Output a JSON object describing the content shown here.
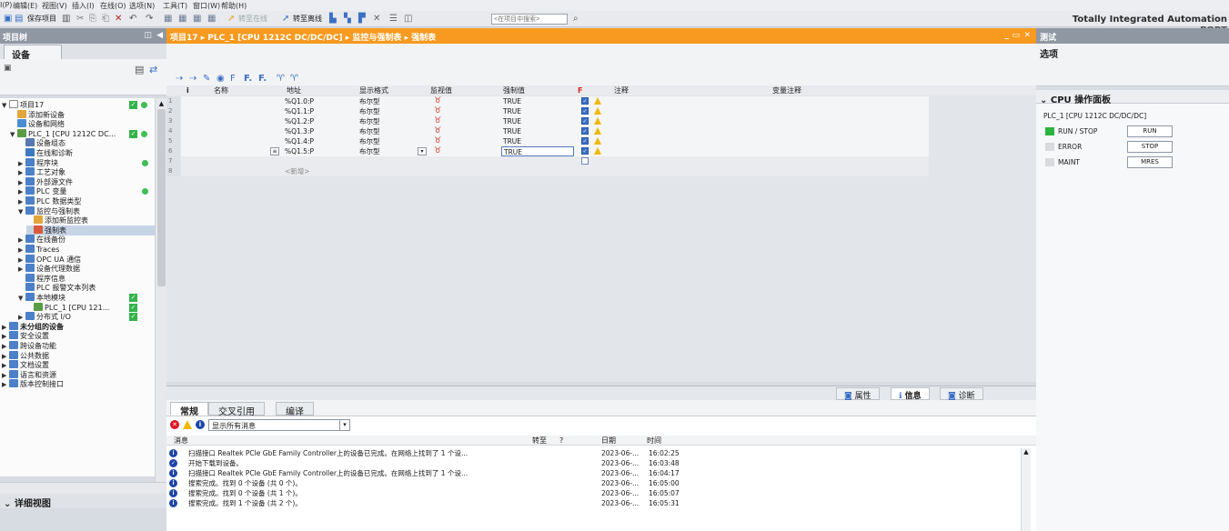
{
  "menu": [
    "I(P)",
    "编辑(E)",
    "视图(V)",
    "插入(I)",
    "在线(O)",
    "选项(N)",
    "工具(T)",
    "窗口(W)",
    "帮助(H)"
  ],
  "toolbar": {
    "save_label": "保存项目",
    "go_online": "转至在线",
    "go_offline": "转至离线",
    "search_placeholder": "<在项目中搜索>"
  },
  "brand": {
    "line1": "Totally Integrated Automation",
    "line2": "PORT"
  },
  "left": {
    "header": "项目树",
    "tab": "设备",
    "tree": [
      {
        "label": "项目17",
        "indent": 0,
        "arrow": "▼",
        "color": "#ffffff",
        "checks": [
          "chk",
          "dot"
        ]
      },
      {
        "label": "添加新设备",
        "indent": 1,
        "arrow": "",
        "color": "#e4a63b"
      },
      {
        "label": "设备和网络",
        "indent": 1,
        "arrow": "",
        "color": "#4a8ed2"
      },
      {
        "label": "PLC_1 [CPU 1212C DC...",
        "indent": 1,
        "arrow": "▼",
        "color": "#5a9c45",
        "checks": [
          "chk",
          "dot"
        ]
      },
      {
        "label": "设备组态",
        "indent": 2,
        "arrow": "",
        "color": "#5578b0"
      },
      {
        "label": "在线和诊断",
        "indent": 2,
        "arrow": "",
        "color": "#3d7ac2"
      },
      {
        "label": "程序块",
        "indent": 2,
        "arrow": "▶",
        "color": "#4c80c8",
        "checks": [
          "dot"
        ]
      },
      {
        "label": "工艺对象",
        "indent": 2,
        "arrow": "▶",
        "color": "#4c80c8"
      },
      {
        "label": "外部源文件",
        "indent": 2,
        "arrow": "▶",
        "color": "#4c80c8"
      },
      {
        "label": "PLC 变量",
        "indent": 2,
        "arrow": "▶",
        "color": "#4c80c8",
        "checks": [
          "dot"
        ]
      },
      {
        "label": "PLC 数据类型",
        "indent": 2,
        "arrow": "▶",
        "color": "#4c80c8"
      },
      {
        "label": "监控与强制表",
        "indent": 2,
        "arrow": "▼",
        "color": "#4c80c8"
      },
      {
        "label": "添加新监控表",
        "indent": 3,
        "arrow": "",
        "color": "#e4a63b"
      },
      {
        "label": "强制表",
        "indent": 3,
        "arrow": "",
        "color": "#d95a3a",
        "selected": true
      },
      {
        "label": "在线备份",
        "indent": 2,
        "arrow": "▶",
        "color": "#4c80c8"
      },
      {
        "label": "Traces",
        "indent": 2,
        "arrow": "▶",
        "color": "#4c80c8"
      },
      {
        "label": "OPC UA 通信",
        "indent": 2,
        "arrow": "▶",
        "color": "#4c80c8"
      },
      {
        "label": "设备代理数据",
        "indent": 2,
        "arrow": "▶",
        "color": "#4c80c8"
      },
      {
        "label": "程序信息",
        "indent": 2,
        "arrow": "",
        "color": "#4c80c8"
      },
      {
        "label": "PLC 报警文本列表",
        "indent": 2,
        "arrow": "",
        "color": "#4c80c8"
      },
      {
        "label": "本地模块",
        "indent": 2,
        "arrow": "▼",
        "color": "#4c80c8",
        "checks": [
          "chk"
        ]
      },
      {
        "label": "PLC_1 [CPU 121...",
        "indent": 3,
        "arrow": "",
        "color": "#5a9c45",
        "checks": [
          "chk"
        ]
      },
      {
        "label": "分布式 I/O",
        "indent": 2,
        "arrow": "▶",
        "color": "#4c80c8",
        "checks": [
          "chk"
        ]
      },
      {
        "label": "未分组的设备",
        "indent": 0,
        "arrow": "▶",
        "color": "#4c80c8",
        "bold": true
      },
      {
        "label": "安全设置",
        "indent": 0,
        "arrow": "▶",
        "color": "#4c80c8"
      },
      {
        "label": "跨设备功能",
        "indent": 0,
        "arrow": "▶",
        "color": "#4c80c8"
      },
      {
        "label": "公共数据",
        "indent": 0,
        "arrow": "▶",
        "color": "#4c80c8"
      },
      {
        "label": "文档设置",
        "indent": 0,
        "arrow": "▶",
        "color": "#4c80c8"
      },
      {
        "label": "语言和资源",
        "indent": 0,
        "arrow": "▶",
        "color": "#4c80c8"
      },
      {
        "label": "版本控制接口",
        "indent": 0,
        "arrow": "▶",
        "color": "#4c80c8"
      }
    ],
    "detail_view": "详细视图"
  },
  "center": {
    "breadcrumb": "项目17 ▸ PLC_1 [CPU 1212C DC/DC/DC] ▸ 监控与强制表 ▸ 强制表",
    "columns": {
      "i": "i",
      "name": "名称",
      "address": "地址",
      "format": "显示格式",
      "monitor": "监视值",
      "force": "强制值",
      "f": "F",
      "comment": "注释",
      "var_comment": "变量注释"
    },
    "rows": [
      {
        "n": "1",
        "address": "%Q1.0:P",
        "format": "布尔型",
        "force": "TRUE",
        "checked": true
      },
      {
        "n": "2",
        "address": "%Q1.1:P",
        "format": "布尔型",
        "force": "TRUE",
        "checked": true
      },
      {
        "n": "3",
        "address": "%Q1.2:P",
        "format": "布尔型",
        "force": "TRUE",
        "checked": true
      },
      {
        "n": "4",
        "address": "%Q1.3:P",
        "format": "布尔型",
        "force": "TRUE",
        "checked": true
      },
      {
        "n": "5",
        "address": "%Q1.4:P",
        "format": "布尔型",
        "force": "TRUE",
        "checked": true
      },
      {
        "n": "6",
        "address": "%Q1.5:P",
        "format": "布尔型",
        "force": "TRUE",
        "checked": true
      },
      {
        "n": "7",
        "address": "",
        "format": "",
        "force": "",
        "checked": false
      },
      {
        "n": "8",
        "address": "<新增>",
        "format": "",
        "force": "",
        "checked": false
      }
    ]
  },
  "bottom": {
    "prop_tabs": [
      "属性",
      "信息",
      "诊断"
    ],
    "info_tabs": [
      "常规",
      "交叉引用",
      "编译"
    ],
    "filter": "显示所有消息",
    "msg_cols": {
      "msg": "消息",
      "goto": "转至",
      "q": "?",
      "date": "日期",
      "time": "时间"
    },
    "messages": [
      {
        "text": "扫描接口 Realtek PCIe GbE Family Controller上的设备已完成。在网络上找到了 1 个设...",
        "date": "2023-06-...",
        "time": "16:02:25",
        "kind": "info"
      },
      {
        "text": "开始下载到设备。",
        "date": "2023-06-...",
        "time": "16:03:48",
        "kind": "ok"
      },
      {
        "text": "扫描接口 Realtek PCIe GbE Family Controller上的设备已完成。在网络上找到了 1 个设...",
        "date": "2023-06-...",
        "time": "16:04:17",
        "kind": "info"
      },
      {
        "text": "搜索完成。找到 0 个设备 (共 0 个)。",
        "date": "2023-06-...",
        "time": "16:05:00",
        "kind": "info"
      },
      {
        "text": "搜索完成。找到 0 个设备 (共 1 个)。",
        "date": "2023-06-...",
        "time": "16:05:07",
        "kind": "info"
      },
      {
        "text": "搜索完成。找到 1 个设备 (共 2 个)。",
        "date": "2023-06-...",
        "time": "16:05:31",
        "kind": "info"
      }
    ]
  },
  "right": {
    "header": "测试",
    "sub": "选项",
    "panel_title": "CPU 操作面板",
    "cpu_name": "PLC_1 [CPU 1212C DC/DC/DC]",
    "leds": [
      {
        "label": "RUN / STOP",
        "button": "RUN",
        "color": "#2cb53e"
      },
      {
        "label": "ERROR",
        "button": "STOP",
        "color": "#d8dadd"
      },
      {
        "label": "MAINT",
        "button": "MRES",
        "color": "#d8dadd"
      }
    ]
  }
}
